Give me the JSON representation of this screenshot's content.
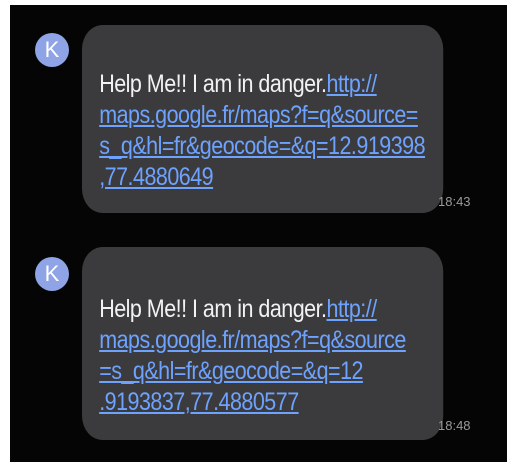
{
  "conversation": {
    "messages": [
      {
        "sender_initial": "K",
        "text": "Help Me!! I am in danger.",
        "link_lines": [
          "http://",
          "maps.google.fr/maps?f=q&source=",
          "s_q&hl=fr&geocode=&q=12.919398",
          ",77.4880649"
        ],
        "time": "18:43"
      },
      {
        "sender_initial": "K",
        "text": "Help Me!! I am in danger.",
        "link_lines": [
          "http://",
          "maps.google.fr/maps?f=q&source",
          "=s_q&hl=fr&geocode=&q=12",
          ".9193837,77.4880577"
        ],
        "time": "18:48"
      }
    ]
  },
  "colors": {
    "background": "#050505",
    "bubble": "#3b3b3d",
    "link": "#6ea2ff",
    "avatar": "#8fa4e6",
    "text": "#f2f2f2",
    "timestamp": "#9a9a9a"
  }
}
